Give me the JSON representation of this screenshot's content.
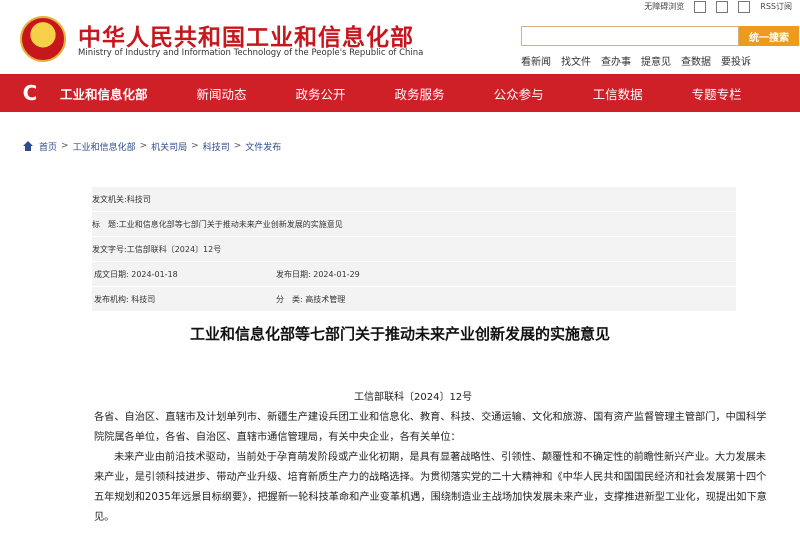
{
  "header": {
    "title": "中华人民共和国工业和信息化部",
    "subtitle": "Ministry of Industry and Information Technology of the People's Republic of China",
    "utils": [
      "无障碍浏览",
      "RSS订阅"
    ],
    "search": {
      "placeholder": "",
      "button": "统一搜索"
    },
    "quick_links": [
      "看新闻",
      "找文件",
      "查办事",
      "查办事",
      "提意见",
      "查数据",
      "要投诉"
    ]
  },
  "nav": {
    "logo": "C",
    "items": [
      "工业和信息化部",
      "新闻动态",
      "政务公开",
      "政务服务",
      "公众参与",
      "工信数据",
      "专题专栏"
    ]
  },
  "breadcrumb": [
    "首页",
    "工业和信息化部",
    "机关司局",
    "科技司",
    "文件发布"
  ],
  "meta": {
    "issuer_label": "发文机关:",
    "issuer": "科技司",
    "title_label": "标　题:",
    "title": "工业和信息化部等七部门关于推动未来产业创新发展的实施意见",
    "docno_label": "发文字号:",
    "docno": "工信部联科〔2024〕12号",
    "written_label": "成文日期:",
    "written": "2024-01-18",
    "published_label": "发布日期:",
    "published": "2024-01-29",
    "agency_label": "发布机构:",
    "agency": "科技司",
    "category_label": "分　类:",
    "category": "高技术管理"
  },
  "article": {
    "title": "工业和信息化部等七部门关于推动未来产业创新发展的实施意见",
    "doc_number": "工信部联科〔2024〕12号",
    "p1": "各省、自治区、直辖市及计划单列市、新疆生产建设兵团工业和信息化、教育、科技、交通运输、文化和旅游、国有资产监督管理主管部门，中国科学院院属各单位，各省、自治区、直辖市通信管理局，有关中央企业，各有关单位：",
    "p2": "未来产业由前沿技术驱动，当前处于孕育萌发阶段或产业化初期，是具有显著战略性、引领性、颠覆性和不确定性的前瞻性新兴产业。大力发展未来产业，是引领科技进步、带动产业升级、培育新质生产力的战略选择。为贯彻落实党的二十大精神和《中华人民共和国国民经济和社会发展第十四个五年规划和2035年远景目标纲要》，把握新一轮科技革命和产业变革机遇，围绕制造业主战场加快发展未来产业，支撑推进新型工业化，现提出如下意见。"
  },
  "colors": {
    "primary": "#cf1f27",
    "accent": "#ec9b1c",
    "link": "#2c4d8f"
  }
}
